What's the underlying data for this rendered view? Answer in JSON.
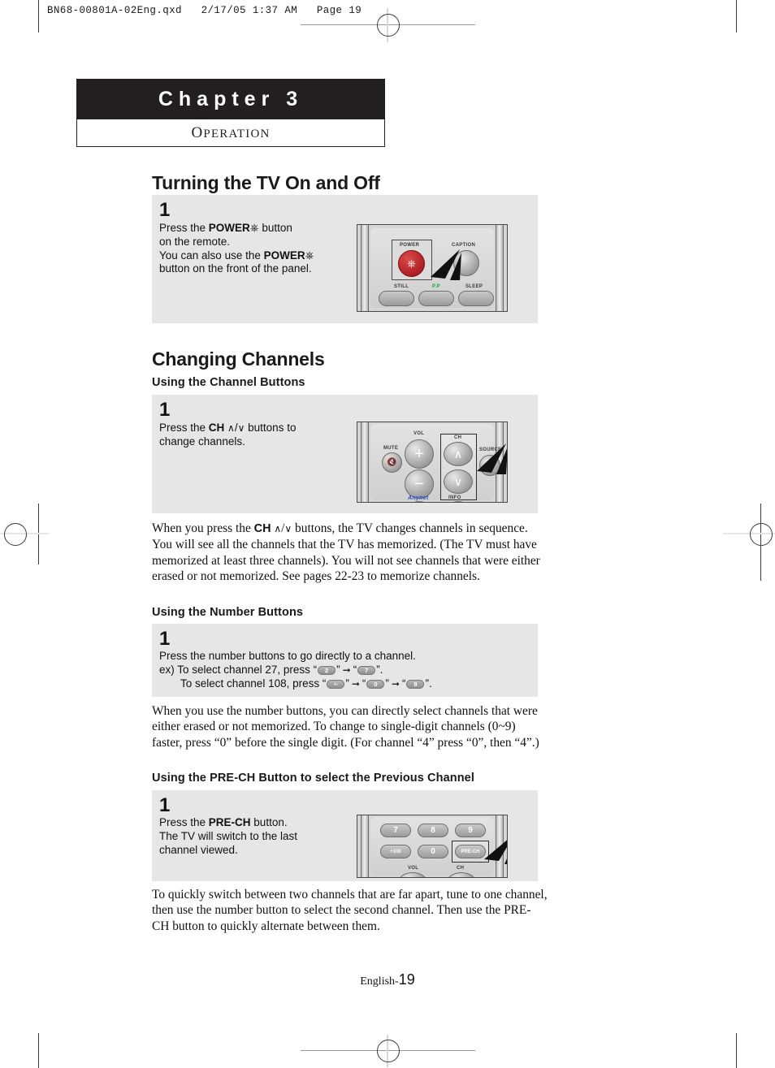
{
  "print_header": "BN68-00801A-02Eng.qxd   2/17/05 1:37 AM   Page 19",
  "chapter": {
    "title": "Chapter 3",
    "subtitle_first": "O",
    "subtitle_rest": "PERATION"
  },
  "sections": [
    {
      "heading": "Turning the TV On and Off",
      "step_number": "1",
      "lines": [
        "Press the POWER  button",
        "on the remote.",
        "You can also use the POWER",
        "button on the front of the panel."
      ]
    },
    {
      "heading": "Changing Channels",
      "subheading": "Using the Channel Buttons",
      "step_number": "1",
      "lines": [
        "Press the CH  /  buttons to",
        "change channels."
      ],
      "paragraph": "When you press the CH  /  buttons, the TV changes channels in sequence. You will see all the channels that the TV has memorized. (The TV must have memorized at least three channels). You will not see channels that were either erased or not memorized. See pages 22-23 to memorize channels."
    },
    {
      "subheading": "Using the Number Buttons",
      "step_number": "1",
      "lines": [
        "Press the number buttons to go directly to a channel.",
        "ex) To select channel 27, press \" 2 \"  \" 7 \".",
        "To select channel 108, press \" -/-- \"  \" 0 \"  \" 8 \"."
      ],
      "example_intro": "ex)",
      "example_line1_prefix": "To select channel 27, press “",
      "example_line2_prefix": "To select channel 108, press “",
      "keys_line1": [
        "2",
        "7"
      ],
      "keys_line2": [
        "-/--",
        "0",
        "8"
      ],
      "paragraph": "When you use the number buttons, you can directly select channels that were either erased or not memorized. To change to single-digit channels (0~9) faster, press “0” before the single digit. (For channel “4” press “0”, then “4”.)"
    },
    {
      "subheading": "Using the PRE-CH Button to select the Previous Channel",
      "step_number": "1",
      "lines": [
        "Press the PRE-CH button.",
        "The TV will switch to the last",
        "channel viewed."
      ],
      "paragraph": "To quickly switch between two channels that are far apart, tune to one channel, then use the number button to select the second channel. Then use the PRE-CH button to quickly alternate between them."
    }
  ],
  "step_text": {
    "s1_l1a": "Press the ",
    "s1_l1b": "POWER",
    "s1_l1c": " button",
    "s1_l2": "on the remote.",
    "s1_l3a": "You can also use the ",
    "s1_l3b": "POWER",
    "s1_l4": "button on the front of the panel.",
    "s2_l1a": "Press the ",
    "s2_l1b": "CH",
    "s2_l1c": " buttons to",
    "s2_l2": "change channels.",
    "s3_l1": "Press the number buttons to go directly to a channel.",
    "s4_l1a": "Press the ",
    "s4_l1b": "PRE-CH",
    "s4_l1c": " button.",
    "s4_l2": "The TV will switch to the last",
    "s4_l3": "channel viewed."
  },
  "paragraphs": {
    "p1_a": "When you press the ",
    "p1_b": "CH",
    "p1_c": " buttons, the TV changes channels in sequence. You will see all the channels that the TV has memorized. (The TV must have memorized at least three channels). You will not see channels that were either erased or not memorized. See pages 22-23 to memorize channels.",
    "p2": "When you use the number buttons, you can directly select channels that were either erased or not memorized. To change to single-digit channels (0~9) faster, press “0” before the single digit. (For channel “4” press “0”, then “4”.)",
    "p3": "To quickly switch between two channels that are far apart, tune to one channel, then use the number button to select the second channel. Then use the PRE-CH button to quickly alternate between them."
  },
  "remote1": {
    "power_label": "POWER",
    "caption_label": "CAPTION",
    "still_label": "STILL",
    "pp_label": "P.P",
    "sleep_label": "SLEEP"
  },
  "remote2": {
    "mute_label": "MUTE",
    "vol_label": "VOL",
    "ch_label": "CH",
    "source_label": "SOURCE",
    "anynet_label": "Anynet",
    "info_label": "INFO",
    "vol_plus": "+",
    "vol_minus": "−"
  },
  "remote3": {
    "keys": [
      "7",
      "8",
      "9",
      "+100",
      "0",
      "PRE-CH"
    ],
    "vol_label": "VOL",
    "ch_label": "CH"
  },
  "footer": {
    "english": "English-",
    "page": "19"
  },
  "colors": {
    "chapter_bar": "#231f20",
    "step_box": "#e6e6e6",
    "power_red": "#b01f26",
    "pp_green": "#11a83a",
    "anynet_blue": "#2b4fc4"
  }
}
